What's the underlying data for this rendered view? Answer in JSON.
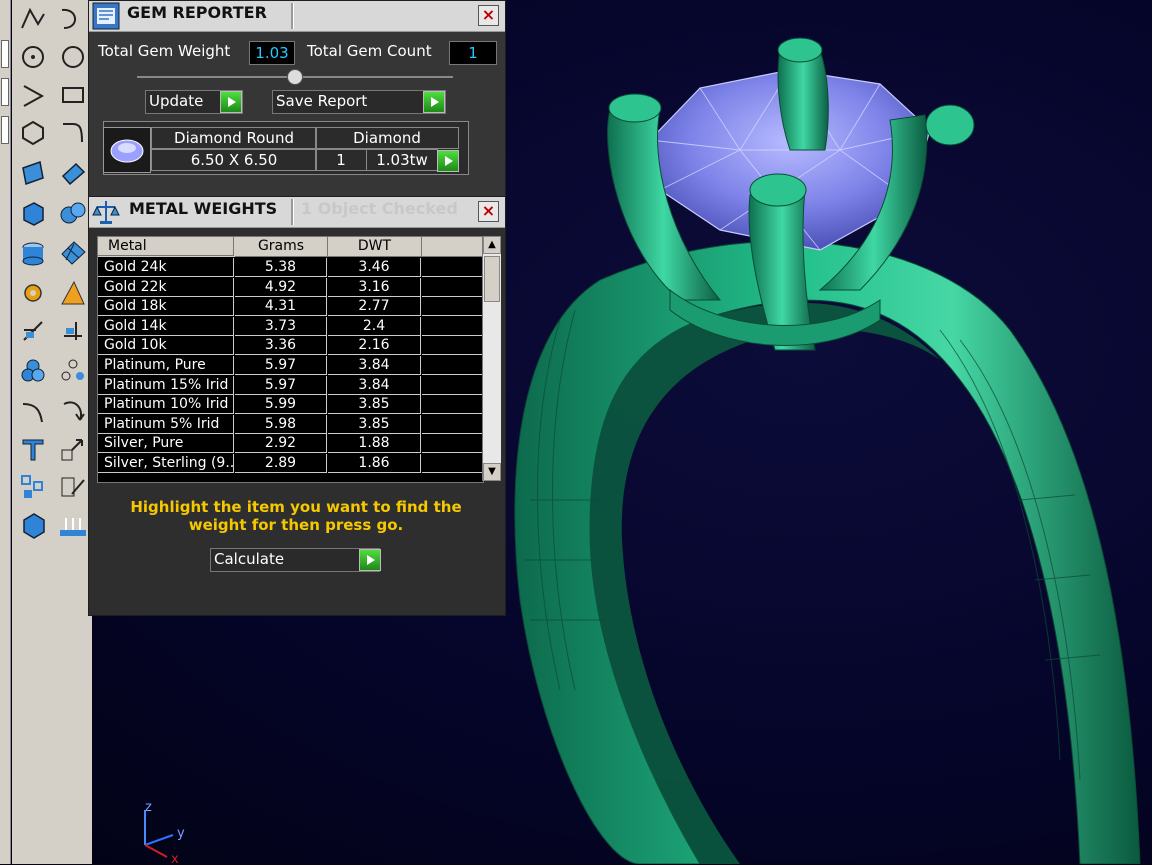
{
  "gem_reporter": {
    "title": "GEM REPORTER",
    "close": "×",
    "total_gem_weight_label": "Total Gem Weight",
    "total_gem_weight_value": "1.03",
    "total_gem_count_label": "Total Gem Count",
    "total_gem_count_value": "1",
    "update_label": "Update",
    "save_report_label": "Save Report",
    "gem": {
      "name": "Diamond Round",
      "size": "6.50 X 6.50",
      "material": "Diamond",
      "count": "1",
      "weight": "1.03tw"
    }
  },
  "metal_weights": {
    "title": "METAL WEIGHTS",
    "status": "1 Object Checked",
    "close": "×",
    "columns": [
      "Metal",
      "Grams",
      "DWT"
    ],
    "rows": [
      {
        "metal": "Gold 24k",
        "grams": "5.38",
        "dwt": "3.46"
      },
      {
        "metal": "Gold 22k",
        "grams": "4.92",
        "dwt": "3.16"
      },
      {
        "metal": "Gold 18k",
        "grams": "4.31",
        "dwt": "2.77"
      },
      {
        "metal": "Gold 14k",
        "grams": "3.73",
        "dwt": "2.4"
      },
      {
        "metal": "Gold 10k",
        "grams": "3.36",
        "dwt": "2.16"
      },
      {
        "metal": "Platinum, Pure",
        "grams": "5.97",
        "dwt": "3.84"
      },
      {
        "metal": "Platinum 15% Irid",
        "grams": "5.97",
        "dwt": "3.84"
      },
      {
        "metal": "Platinum 10% Irid",
        "grams": "5.99",
        "dwt": "3.85"
      },
      {
        "metal": "Platinum 5% Irid",
        "grams": "5.98",
        "dwt": "3.85"
      },
      {
        "metal": "Silver, Pure",
        "grams": "2.92",
        "dwt": "1.88"
      },
      {
        "metal": "Silver, Sterling (9...",
        "grams": "2.89",
        "dwt": "1.86"
      }
    ],
    "hint": "Highlight the item you want to find the weight for then press go.",
    "calculate_label": "Calculate"
  },
  "axes": {
    "x": "x",
    "y": "y",
    "z": "z"
  },
  "colors": {
    "accent_value": "#28c8ff",
    "hint": "#f5c800",
    "go": "#2fb324",
    "ring": "#1aa878",
    "gem": "#8a8ef0"
  }
}
